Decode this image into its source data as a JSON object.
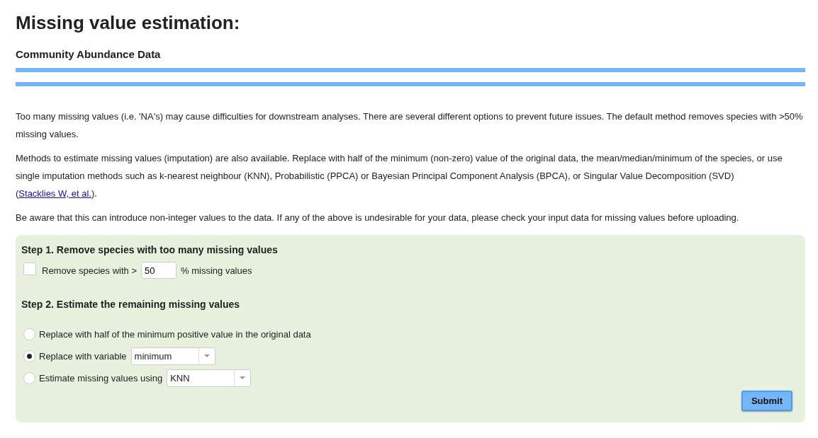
{
  "title": "Missing value estimation:",
  "subtitle": "Community Abundance Data",
  "paragraphs": [
    {
      "text": "Too many missing values (i.e. 'NA's) may cause difficulties for downstream analyses. There are several different options to prevent future issues. The default method removes species with >50% missing values."
    },
    {
      "text": "Methods to estimate missing values (imputation) are also available. Replace with half of the minimum (non-zero) value of the original data, the mean/median/minimum of the species, or use single imputation methods such as k-nearest neighbour (KNN), Probabilistic (PPCA) or Bayesian Principal Component Analysis (BPCA), or Singular Value Decomposition (SVD) (",
      "link": "Stacklies W, et al.",
      "after": ")."
    },
    {
      "text": "Be aware that this can introduce non-integer values to the data. If any of the above is undesirable for your data, please check your input data for missing values before uploading."
    }
  ],
  "step1": {
    "heading": "Step 1. Remove species with too many missing values",
    "checked": false,
    "label_before": "Remove species with >",
    "value": "50",
    "label_after": "% missing values"
  },
  "step2": {
    "heading": "Step 2. Estimate the remaining missing values",
    "options": [
      {
        "kind": "plain",
        "label": "Replace with half of the minimum positive value in the original data",
        "selected": false
      },
      {
        "kind": "select",
        "label": "Replace with variable",
        "value": "minimum",
        "selected": true
      },
      {
        "kind": "select",
        "label": "Estimate missing values using",
        "value": "KNN",
        "selected": false
      }
    ]
  },
  "submit": "Submit"
}
